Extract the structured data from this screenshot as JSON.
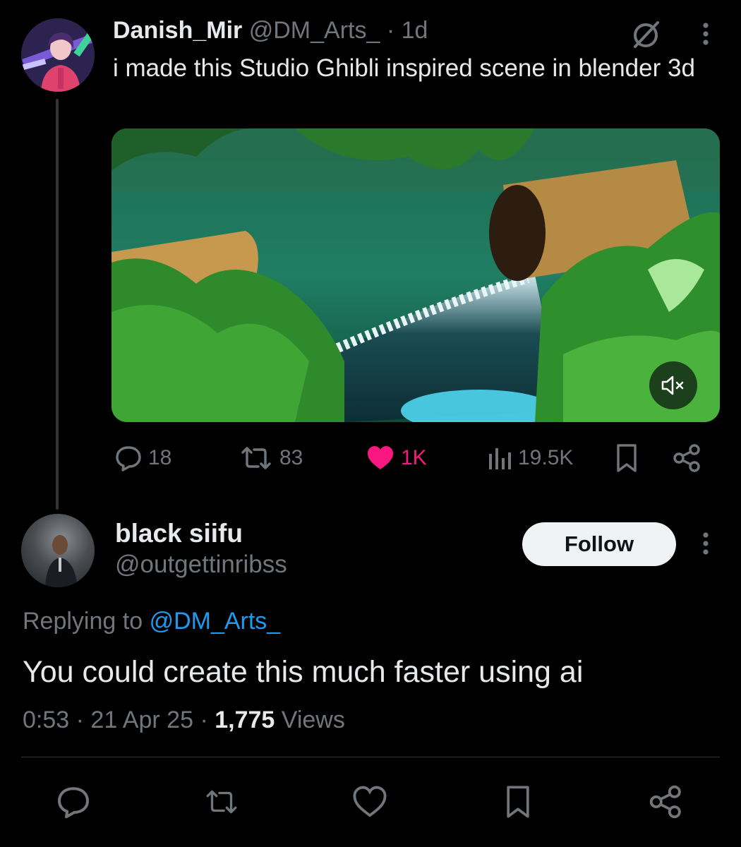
{
  "parent_tweet": {
    "display_name": "Danish_Mir",
    "handle": "@DM_Arts_",
    "separator": "·",
    "age": "1d",
    "text": "i made this Studio Ghibli inspired scene in blender 3d",
    "media": {
      "type": "video",
      "muted": true,
      "icon": "speaker-muted-icon"
    },
    "actions": {
      "reply_count": "18",
      "retweet_count": "83",
      "like_count": "1K",
      "view_count": "19.5K",
      "liked": true
    }
  },
  "reply_tweet": {
    "display_name": "black siifu",
    "handle": "@outgettinribss",
    "follow_label": "Follow",
    "replying_prefix": "Replying to",
    "replying_to": "@DM_Arts_",
    "text": "You could create this much faster using ai",
    "time": "0:53",
    "date": "21 Apr 25",
    "views_number": "1,775",
    "views_label": "Views",
    "separator": "·"
  },
  "colors": {
    "background": "#000000",
    "primary_text": "#e7e9ea",
    "muted_text": "#71767b",
    "link": "#1d9bf0",
    "like": "#f91880",
    "follow_button_bg": "#eff3f4"
  },
  "icons": {
    "header": [
      "grok-icon",
      "more-icon"
    ],
    "actions": [
      "reply-icon",
      "retweet-icon",
      "like-icon",
      "views-icon",
      "bookmark-icon",
      "share-icon"
    ]
  }
}
